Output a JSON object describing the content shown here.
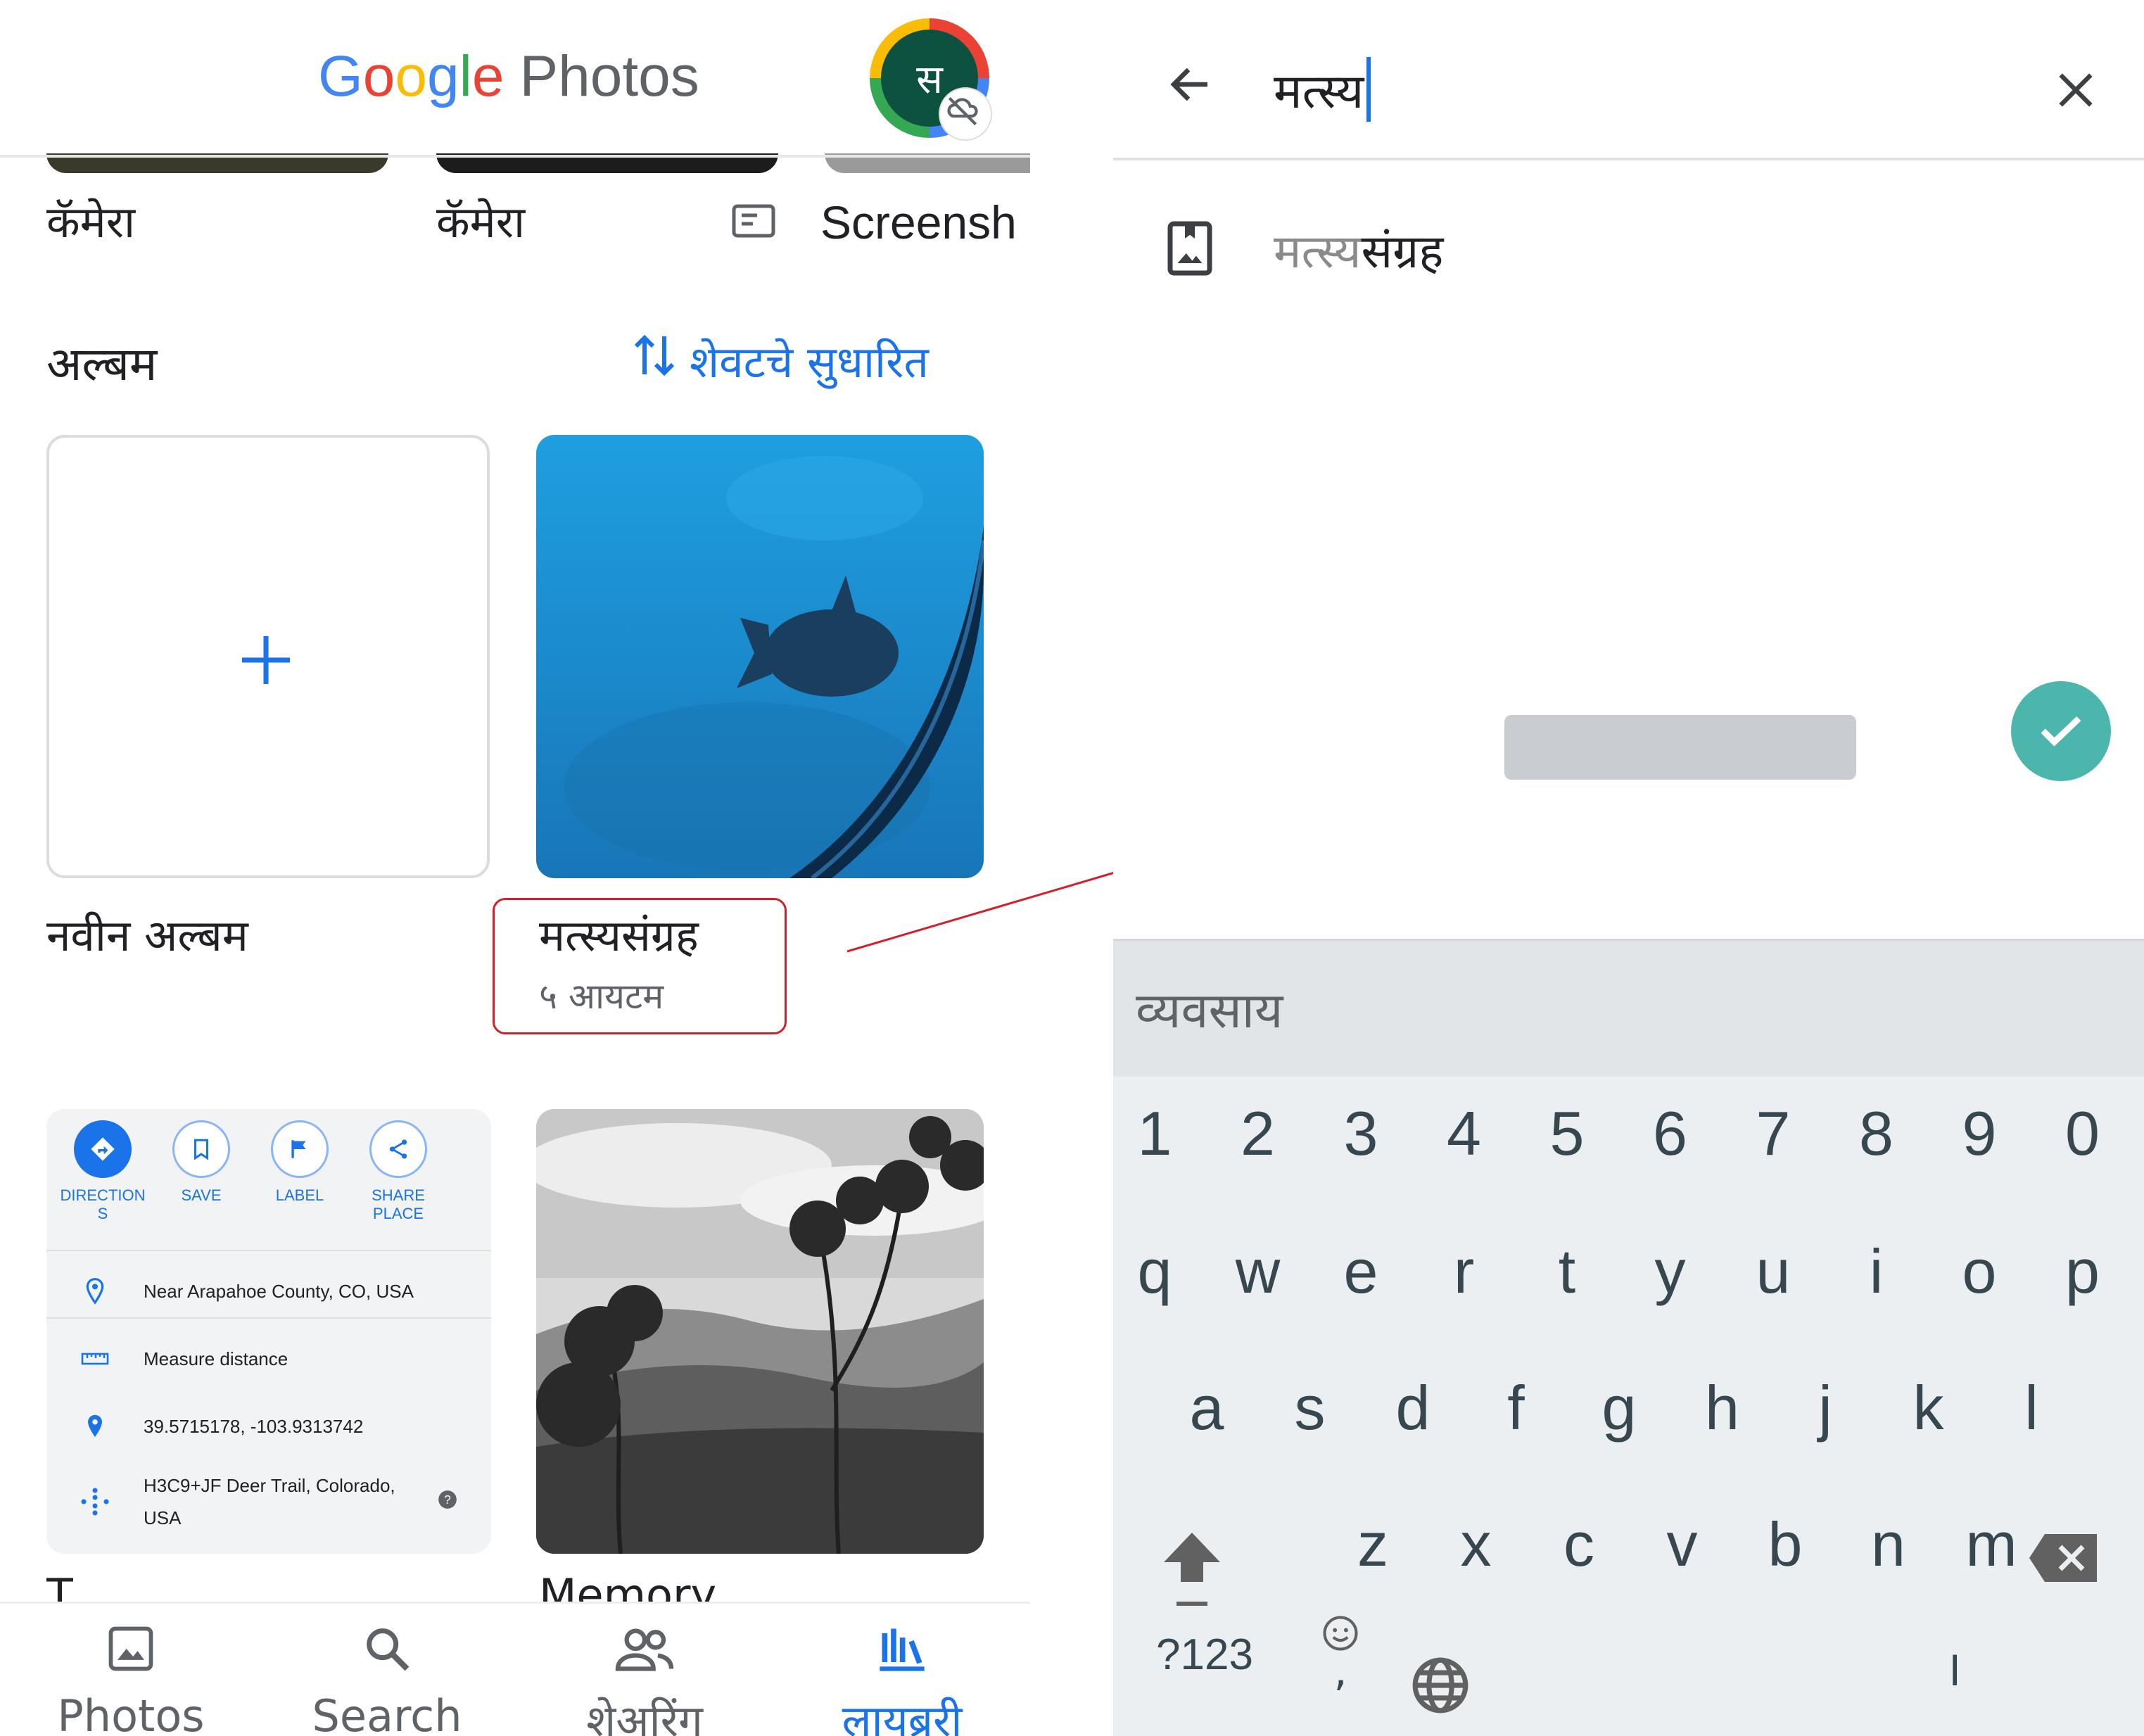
{
  "photos_app": {
    "logo": {
      "google": [
        "G",
        "o",
        "o",
        "g",
        "l",
        "e"
      ],
      "product": "Photos"
    },
    "avatar_initial": "स",
    "top_strip": {
      "labels": [
        "कॅमेरा",
        "कॅमेरा",
        "Screensh"
      ]
    },
    "albums_section": {
      "title": "अल्बम",
      "sort_label": "शेवटचे सुधारित",
      "new_album_label": "नवीन अल्बम",
      "album": {
        "name": "मत्स्यसंग्रह",
        "count": "५ आयटम"
      },
      "partial_captions": [
        "T",
        "Memory"
      ]
    },
    "map_card": {
      "actions": [
        "DIRECTION\nS",
        "SAVE",
        "LABEL",
        "SHARE\nPLACE"
      ],
      "rows": [
        "Near Arapahoe County, CO, USA",
        "Measure distance",
        "39.5715178, -103.9313742",
        "H3C9+JF Deer Trail, Colorado,\nUSA"
      ]
    },
    "bottom_nav": [
      {
        "label": "Photos",
        "icon": "photo-icon"
      },
      {
        "label": "Search",
        "icon": "search-icon"
      },
      {
        "label": "शेअरिंग",
        "icon": "people-icon"
      },
      {
        "label": "लायब्ररी",
        "icon": "library-icon",
        "active": true
      }
    ]
  },
  "search_screen": {
    "query": "मत्स्य",
    "suggestion": {
      "match": "मत्स्य",
      "rest": "संग्रह"
    },
    "keyboard": {
      "suggestion_strip": "व्यवसाय",
      "row_numbers": [
        "1",
        "2",
        "3",
        "4",
        "5",
        "6",
        "7",
        "8",
        "9",
        "0"
      ],
      "row_1": [
        "q",
        "w",
        "e",
        "r",
        "t",
        "y",
        "u",
        "i",
        "o",
        "p"
      ],
      "row_2": [
        "a",
        "s",
        "d",
        "f",
        "g",
        "h",
        "j",
        "k",
        "l"
      ],
      "row_3": [
        "z",
        "x",
        "c",
        "v",
        "b",
        "n",
        "m"
      ],
      "symbols_key": "?123",
      "comma_key": ",",
      "period_key": "।"
    }
  },
  "colors": {
    "accent": "#1a73e8",
    "callout": "#d4202a",
    "enter_key": "#4db6ac",
    "avatar_bg": "#0d5240"
  }
}
